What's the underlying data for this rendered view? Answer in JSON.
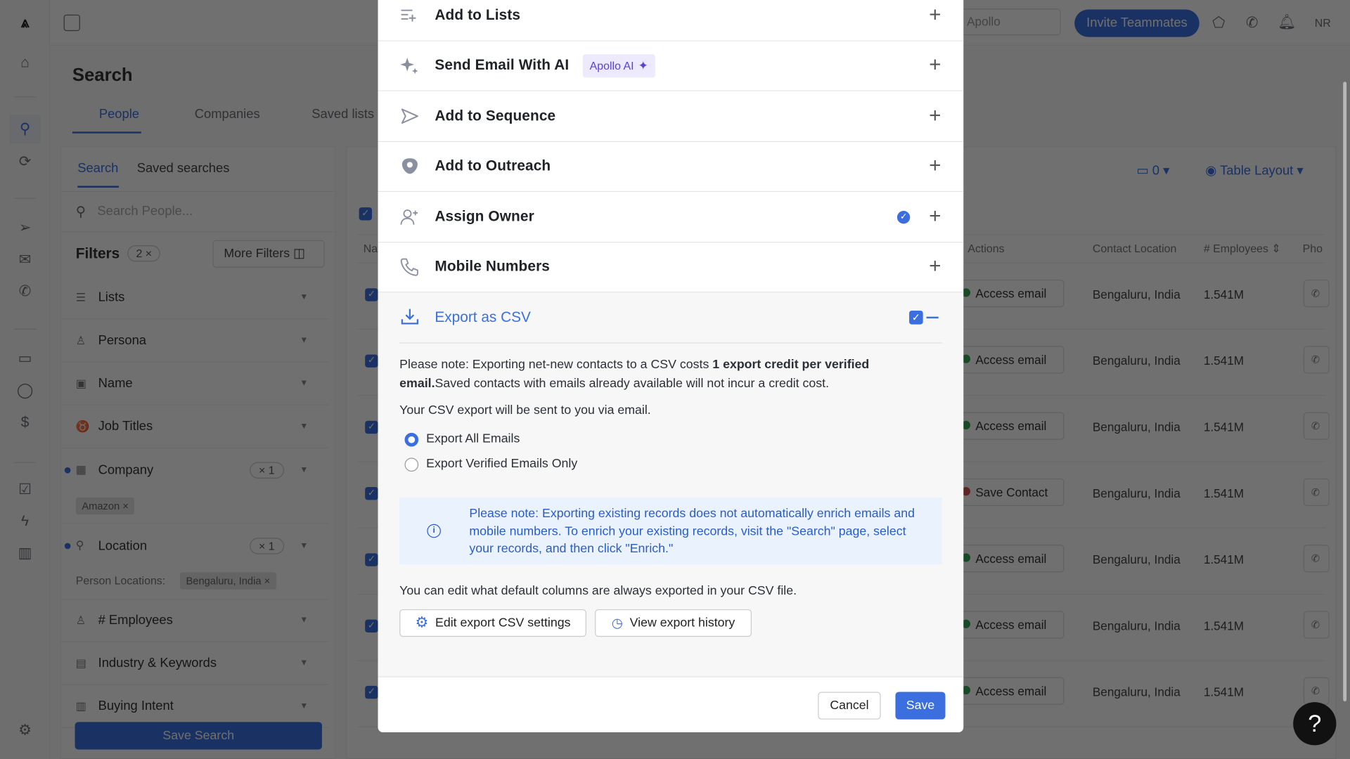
{
  "app": {
    "topbar": {
      "search_value": "Apollo",
      "invite_label": "Invite Teammates",
      "user_initials": "NR"
    },
    "page_title": "Search",
    "tabs": [
      {
        "label": "People",
        "active": true
      },
      {
        "label": "Companies"
      },
      {
        "label": "Saved lists"
      }
    ],
    "left_panel": {
      "subtabs": [
        {
          "label": "Search",
          "active": true
        },
        {
          "label": "Saved searches"
        }
      ],
      "search_placeholder": "Search People...",
      "filters_label": "Filters",
      "filters_count": "2",
      "more_filters_label": "More Filters",
      "filters": [
        {
          "label": "Lists",
          "icon": "list-icon"
        },
        {
          "label": "Persona",
          "icon": "persona-icon"
        },
        {
          "label": "Name",
          "icon": "name-icon"
        },
        {
          "label": "Job Titles",
          "icon": "job-titles-icon"
        },
        {
          "label": "Company",
          "icon": "building-icon",
          "count": "1",
          "chip": "Amazon"
        },
        {
          "label": "Location",
          "icon": "pin-icon",
          "count": "1",
          "sublabel": "Person Locations:",
          "chip": "Bengaluru, India"
        },
        {
          "label": "# Employees",
          "icon": "people-icon"
        },
        {
          "label": "Industry & Keywords",
          "icon": "industry-icon"
        },
        {
          "label": "Buying Intent",
          "icon": "chart-icon"
        }
      ],
      "save_search_label": "Save Search"
    },
    "table": {
      "toolbar": {
        "credits": "0",
        "layout_label": "Table Layout"
      },
      "columns": [
        "Na",
        "Actions",
        "Contact Location",
        "# Employees",
        "Pho"
      ],
      "rows": [
        {
          "action": "Access email",
          "location": "Bengaluru, India",
          "employees": "1.541M"
        },
        {
          "action": "Access email",
          "location": "Bengaluru, India",
          "employees": "1.541M"
        },
        {
          "action": "Access email",
          "location": "Bengaluru, India",
          "employees": "1.541M"
        },
        {
          "action": "Save Contact",
          "location": "Bengaluru, India",
          "employees": "1.541M"
        },
        {
          "action": "Access email",
          "location": "Bengaluru, India",
          "employees": "1.541M"
        },
        {
          "action": "Access email",
          "location": "Bengaluru, India",
          "employees": "1.541M"
        },
        {
          "action": "Access email",
          "location": "Bengaluru, India",
          "employees": "1.541M"
        }
      ]
    }
  },
  "modal": {
    "rows": [
      {
        "label": "Add to Lists",
        "icon": "add-list-icon"
      },
      {
        "label": "Send Email With AI",
        "icon": "sparkle-icon",
        "badge": "Apollo AI"
      },
      {
        "label": "Add to Sequence",
        "icon": "send-icon"
      },
      {
        "label": "Add to Outreach",
        "icon": "outreach-icon"
      },
      {
        "label": "Assign Owner",
        "icon": "user-plus-icon",
        "checked": true
      },
      {
        "label": "Mobile Numbers",
        "icon": "phone-icon"
      }
    ],
    "export": {
      "label": "Export as CSV",
      "enabled": true,
      "note_prefix": "Please note: Exporting net-new contacts to a CSV costs ",
      "note_bold": "1 export credit per verified email.",
      "note_suffix": "Saved contacts with emails already available will not incur a credit cost.",
      "sent_note": "Your CSV export will be sent to you via email.",
      "options": [
        {
          "label": "Export All Emails",
          "selected": true
        },
        {
          "label": "Export Verified Emails Only",
          "selected": false
        }
      ],
      "info": "Please note: Exporting existing records does not automatically enrich emails and mobile numbers. To enrich your existing records, visit the \"Search\" page, select your records, and then click \"Enrich.\"",
      "columns_note": "You can edit what default columns are always exported in your CSV file.",
      "edit_settings_label": "Edit export CSV settings",
      "history_label": "View export history"
    },
    "cancel_label": "Cancel",
    "save_label": "Save"
  },
  "help_label": "?",
  "colors": {
    "accent": "#3b6fe0",
    "ai_badge_bg": "#ede9fe",
    "ai_badge_text": "#5b3fd6",
    "info_bg": "#eaf2fe"
  }
}
